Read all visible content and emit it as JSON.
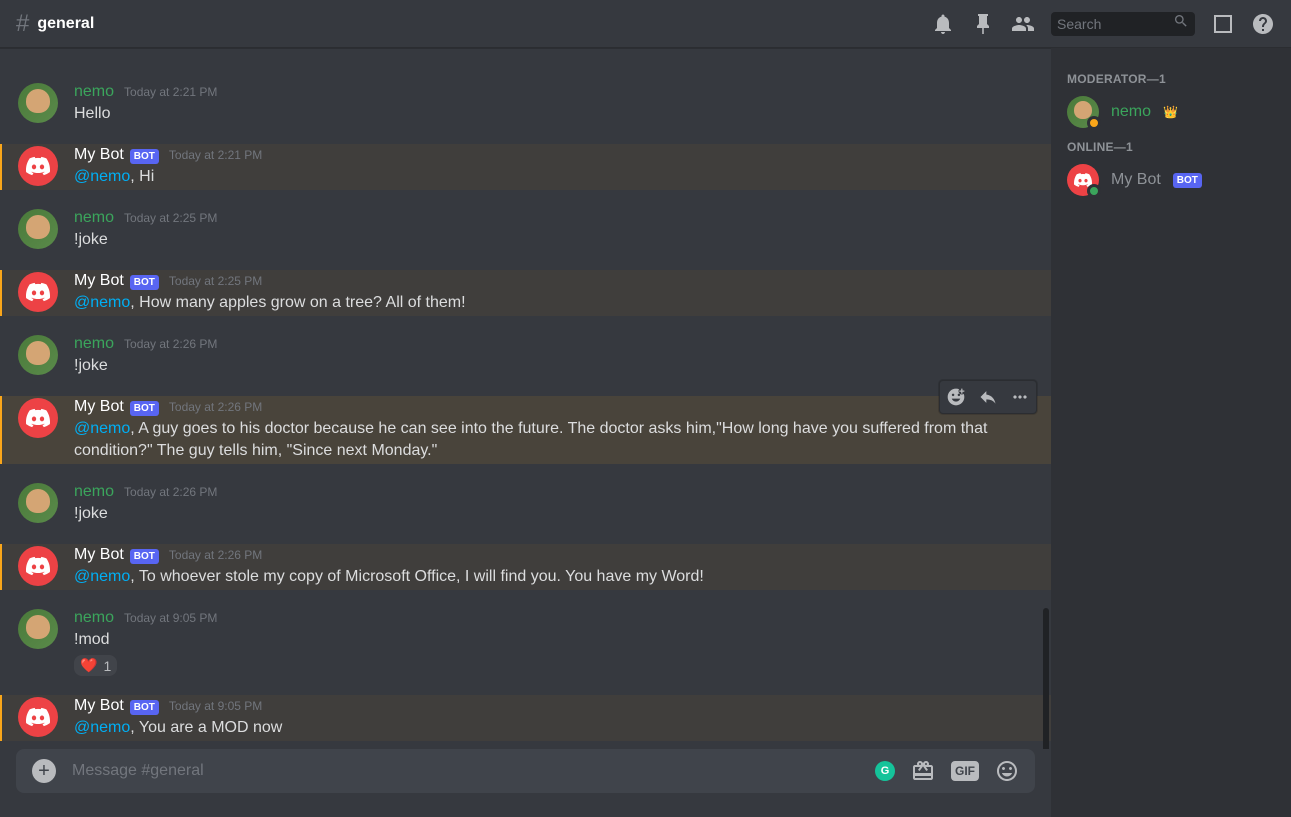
{
  "header": {
    "channel_name": "general",
    "search_placeholder": "Search"
  },
  "messages": [
    {
      "author": "nemo",
      "isBot": false,
      "timestamp": "Today at 2:21 PM",
      "content": "Hello",
      "highlighted": false
    },
    {
      "author": "My Bot",
      "isBot": true,
      "timestamp": "Today at 2:21 PM",
      "mention": "@nemo",
      "content": ", Hi",
      "highlighted": true
    },
    {
      "author": "nemo",
      "isBot": false,
      "timestamp": "Today at 2:25 PM",
      "content": "!joke",
      "highlighted": false
    },
    {
      "author": "My Bot",
      "isBot": true,
      "timestamp": "Today at 2:25 PM",
      "mention": "@nemo",
      "content": ", How many apples grow on a tree? All of them!",
      "highlighted": true
    },
    {
      "author": "nemo",
      "isBot": false,
      "timestamp": "Today at 2:26 PM",
      "content": "!joke",
      "highlighted": false
    },
    {
      "author": "My Bot",
      "isBot": true,
      "timestamp": "Today at 2:26 PM",
      "mention": "@nemo",
      "content": ", A guy goes to his doctor because he can see into the future. The doctor asks him,\"How long have you suffered from that condition?\" The guy tells him, \"Since next Monday.\"",
      "highlighted": true,
      "hovered": true
    },
    {
      "author": "nemo",
      "isBot": false,
      "timestamp": "Today at 2:26 PM",
      "content": "!joke",
      "highlighted": false
    },
    {
      "author": "My Bot",
      "isBot": true,
      "timestamp": "Today at 2:26 PM",
      "mention": "@nemo",
      "content": ", To whoever stole my copy of Microsoft Office, I will find you. You have my Word!",
      "highlighted": true
    },
    {
      "author": "nemo",
      "isBot": false,
      "timestamp": "Today at 9:05 PM",
      "content": "!mod",
      "highlighted": false,
      "reaction": {
        "emoji": "❤️",
        "count": "1"
      }
    },
    {
      "author": "My Bot",
      "isBot": true,
      "timestamp": "Today at 9:05 PM",
      "mention": "@nemo",
      "content": ", You are a MOD now",
      "highlighted": true
    }
  ],
  "bot_tag": "BOT",
  "input": {
    "placeholder": "Message #general",
    "gif_label": "GIF"
  },
  "members": {
    "groups": [
      {
        "title": "MODERATOR—1",
        "members": [
          {
            "name": "nemo",
            "isBot": false,
            "status": "idle",
            "isOwner": true,
            "color": "nemo"
          }
        ]
      },
      {
        "title": "ONLINE—1",
        "members": [
          {
            "name": "My Bot",
            "isBot": true,
            "status": "online",
            "isOwner": false,
            "color": "default"
          }
        ]
      }
    ]
  }
}
